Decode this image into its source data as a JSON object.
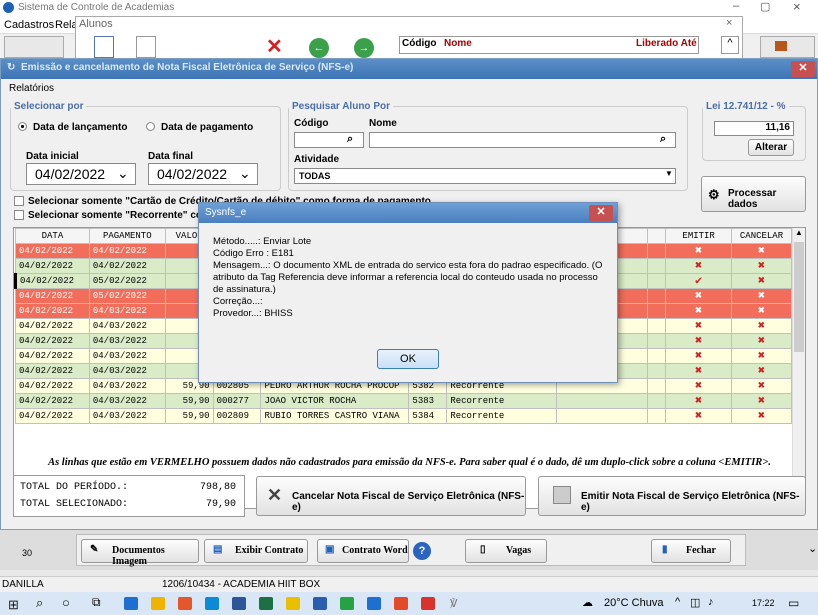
{
  "app": {
    "title": "Sistema de Controle de Academias",
    "menu": [
      "Cadastros",
      "Rela"
    ]
  },
  "alunos": {
    "title": "Alunos",
    "cols": [
      "Código",
      "Nome",
      "Liberado Até"
    ]
  },
  "nfse": {
    "title": "Emissão e cancelamento de Nota Fiscal Eletrônica de Serviço (NFS-e)",
    "menu_relatorios": "Relatórios",
    "selecionar_por": {
      "legend": "Selecionar por",
      "opt_lanc": "Data de lançamento",
      "opt_pag": "Data de pagamento",
      "data_inicial_label": "Data inicial",
      "data_final_label": "Data final",
      "data_inicial": "04/02/2022",
      "data_final": "04/02/2022"
    },
    "pesquisar": {
      "legend": "Pesquisar Aluno Por",
      "codigo_label": "Código",
      "nome_label": "Nome",
      "atividade_label": "Atividade",
      "atividade_value": "TODAS"
    },
    "lei": {
      "legend": "Lei 12.741/12 - %",
      "value": "11,16",
      "alterar": "Alterar"
    },
    "processar": "Processar dados",
    "chk_cartao": "Selecionar somente \"Cartão de Crédito/Cartão de débito\" como forma de pagamento",
    "chk_recorrente": "Selecionar somente \"Recorrente\" con",
    "grid": {
      "headers": [
        "DATA",
        "PAGAMENTO",
        "VALOR",
        "",
        "",
        "",
        "",
        "FISCAL",
        "EMITIR",
        "CANCELAR"
      ],
      "rows": [
        {
          "data": "04/02/2022",
          "pag": "04/02/2022",
          "valor": "79",
          "cod": "",
          "nome": "",
          "num": "",
          "tipo": "",
          "color": "red",
          "emitir": "x"
        },
        {
          "data": "04/02/2022",
          "pag": "04/02/2022",
          "valor": "79",
          "cod": "",
          "nome": "",
          "num": "",
          "tipo": "",
          "color": "green",
          "emitir": "x"
        },
        {
          "data": "04/02/2022",
          "pag": "05/02/2022",
          "valor": "79",
          "cod": "",
          "nome": "",
          "num": "",
          "tipo": "",
          "color": "green",
          "emitir": "check"
        },
        {
          "data": "04/02/2022",
          "pag": "05/02/2022",
          "valor": "79",
          "cod": "",
          "nome": "",
          "num": "",
          "tipo": "",
          "color": "red",
          "emitir": "x"
        },
        {
          "data": "04/02/2022",
          "pag": "04/03/2022",
          "valor": "59",
          "cod": "",
          "nome": "",
          "num": "",
          "tipo": "",
          "color": "red",
          "emitir": "x"
        },
        {
          "data": "04/02/2022",
          "pag": "04/03/2022",
          "valor": "59",
          "cod": "",
          "nome": "",
          "num": "",
          "tipo": "",
          "color": "yellow",
          "emitir": "x"
        },
        {
          "data": "04/02/2022",
          "pag": "04/03/2022",
          "valor": "59",
          "cod": "",
          "nome": "",
          "num": "",
          "tipo": "",
          "color": "green",
          "emitir": "x"
        },
        {
          "data": "04/02/2022",
          "pag": "04/03/2022",
          "valor": "59",
          "cod": "",
          "nome": "",
          "num": "",
          "tipo": "",
          "color": "yellow",
          "emitir": "x"
        },
        {
          "data": "04/02/2022",
          "pag": "04/03/2022",
          "valor": "59",
          "cod": "",
          "nome": "",
          "num": "",
          "tipo": "",
          "color": "green",
          "emitir": "x"
        },
        {
          "data": "04/02/2022",
          "pag": "04/03/2022",
          "valor": "59,90",
          "cod": "002805",
          "nome": "PEDRO ARTHUR ROCHA PROCOP",
          "num": "5382",
          "tipo": "Recorrente",
          "color": "yellow",
          "emitir": "x"
        },
        {
          "data": "04/02/2022",
          "pag": "04/03/2022",
          "valor": "59,90",
          "cod": "000277",
          "nome": "JOAO VICTOR ROCHA",
          "num": "5383",
          "tipo": "Recorrente",
          "color": "green",
          "emitir": "x"
        },
        {
          "data": "04/02/2022",
          "pag": "04/03/2022",
          "valor": "59,90",
          "cod": "002809",
          "nome": "RUBIO TORRES CASTRO VIANA",
          "num": "5384",
          "tipo": "Recorrente",
          "color": "yellow",
          "emitir": "x"
        }
      ]
    },
    "note": "As linhas que estão em VERMELHO possuem dados não cadastrados para emissão da NFS-e. Para saber qual é o dado, dê um duplo-click sobre a coluna <EMITIR>.",
    "totals": {
      "periodo_label": "TOTAL DO PERÍODO.:",
      "periodo": "798,80",
      "sel_label": "TOTAL SELECIONADO:",
      "sel": "79,90"
    },
    "cancelar_btn": "Cancelar Nota Fiscal de Serviço Eletrônica (NFS-e)",
    "emitir_btn": "Emitir Nota Fiscal de Serviço Eletrônica (NFS-e)"
  },
  "dialog": {
    "title": "Sysnfs_e",
    "lines": [
      "Método.....: Enviar Lote",
      "Código Erro : E181",
      "Mensagem...: O documento XML de entrada do servico esta fora do padrao especificado. (O atributo da Tag Referencia deve informar a referencia local do conteudo usada no processo de assinatura.)",
      "Correção...:",
      "Provedor...: BHISS"
    ],
    "ok": "OK"
  },
  "bottombar": {
    "num": "30",
    "documentos": "Documentos Imagem",
    "exibir": "Exibir Contrato",
    "contrato_word": "Contrato Word",
    "vagas": "Vagas",
    "fechar": "Fechar"
  },
  "status": {
    "user": "DANILLA",
    "info": "1206/10434 - ACADEMIA HIIT BOX"
  },
  "taskbar": {
    "weather": "20°C  Chuva",
    "time": "17:22"
  }
}
